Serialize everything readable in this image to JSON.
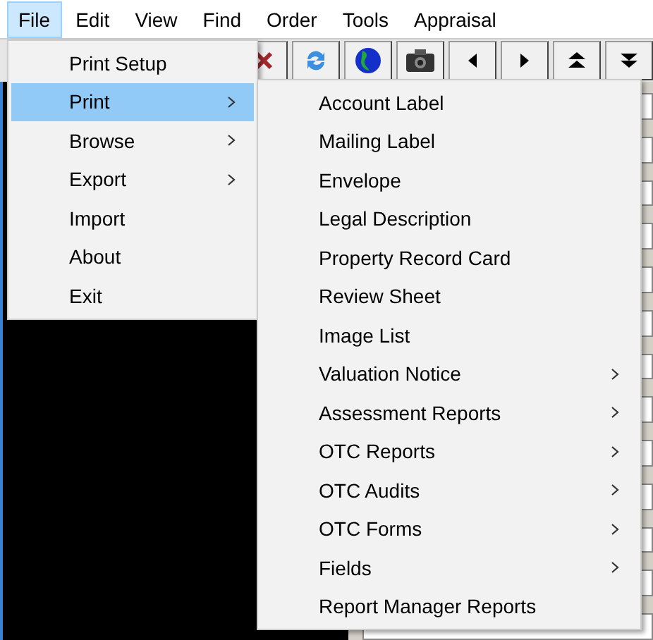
{
  "menu_bar": [
    {
      "label": "File",
      "selected": true
    },
    {
      "label": "Edit",
      "selected": false
    },
    {
      "label": "View",
      "selected": false
    },
    {
      "label": "Find",
      "selected": false
    },
    {
      "label": "Order",
      "selected": false
    },
    {
      "label": "Tools",
      "selected": false
    },
    {
      "label": "Appraisal",
      "selected": false
    }
  ],
  "file_menu": [
    {
      "label": "Print Setup",
      "submenu": false,
      "selected": false
    },
    {
      "label": "Print",
      "submenu": true,
      "selected": true
    },
    {
      "label": "Browse",
      "submenu": true,
      "selected": false
    },
    {
      "label": "Export",
      "submenu": true,
      "selected": false
    },
    {
      "label": "Import",
      "submenu": false,
      "selected": false
    },
    {
      "label": "About",
      "submenu": false,
      "selected": false
    },
    {
      "label": "Exit",
      "submenu": false,
      "selected": false
    }
  ],
  "print_submenu": [
    {
      "label": "Account Label",
      "submenu": false
    },
    {
      "label": "Mailing Label",
      "submenu": false
    },
    {
      "label": "Envelope",
      "submenu": false
    },
    {
      "label": "Legal Description",
      "submenu": false
    },
    {
      "label": "Property Record Card",
      "submenu": false
    },
    {
      "label": "Review Sheet",
      "submenu": false
    },
    {
      "label": "Image List",
      "submenu": false
    },
    {
      "label": "Valuation Notice",
      "submenu": true
    },
    {
      "label": "Assessment Reports",
      "submenu": true
    },
    {
      "label": "OTC Reports",
      "submenu": true
    },
    {
      "label": "OTC Audits",
      "submenu": true
    },
    {
      "label": "OTC Forms",
      "submenu": true
    },
    {
      "label": "Fields",
      "submenu": true
    },
    {
      "label": "Report Manager Reports",
      "submenu": false
    }
  ]
}
